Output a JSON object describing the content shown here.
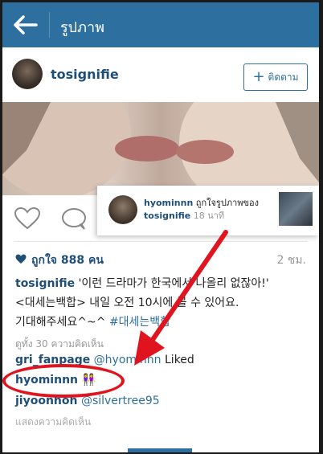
{
  "topbar": {
    "title": "รูปภาพ",
    "bg_color": "#2d6f9f"
  },
  "post": {
    "username": "tosignifie",
    "follow_label": "ติดตาม",
    "likes_text": "ถูกใจ 888 คน",
    "time": "2 ชม."
  },
  "notification": {
    "user": "hyominnn",
    "action": "ถูกใจรูปภาพของ",
    "target": "tosignifie",
    "time": "18 นาที"
  },
  "caption": {
    "user": "tosignifie",
    "line1": "'이런 드라마가 한국에서 나올리 없잖아!'",
    "line2": "<대세는백합> 내일 오전 10시에 볼 수 있어요.",
    "line3": "기대해주세요^~^",
    "hashtag": "#대세는백합"
  },
  "view_all_comments": "ดูทั้ง 30 ความคิดเห็น",
  "comments": [
    {
      "user": "gri_fanpage",
      "mention": "@hyominnn",
      "text": "Liked"
    },
    {
      "user": "hyominnn",
      "emoji": "👭"
    },
    {
      "user": "jiyoonhoh",
      "mention": "@silvertree95"
    }
  ],
  "add_comment_placeholder": "แสดงความคิดเห็น",
  "colors": {
    "accent": "#2d6f9f",
    "highlight": "#e0141e",
    "username": "#1f4e79"
  }
}
